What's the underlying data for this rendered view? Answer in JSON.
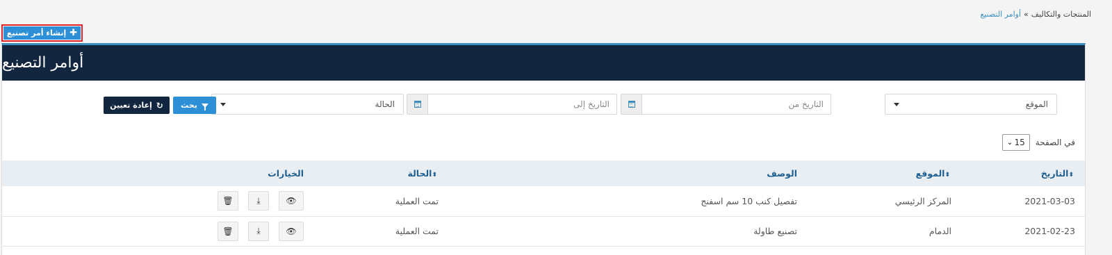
{
  "breadcrumb": {
    "root": "المنتجات والتكاليف",
    "separator": "»",
    "current": "أوامر التصنيع"
  },
  "create_button": {
    "label": "إنشاء أمر تصنيع",
    "icon": "plus-icon"
  },
  "panel": {
    "title": "أوامر التصنيع"
  },
  "filters": {
    "location": {
      "value": "الموقع"
    },
    "date_from": {
      "placeholder": "التاريخ من"
    },
    "date_to": {
      "placeholder": "التاريخ  إلى"
    },
    "status": {
      "value": "الحالة"
    },
    "search_button": "بحث",
    "reset_button": "إعادة تعيين"
  },
  "per_page": {
    "label": "في الصفحة",
    "value": "15"
  },
  "table": {
    "headers": {
      "date": "التاريخ",
      "location": "الموقع",
      "description": "الوصف",
      "status": "الحالة",
      "options": "الخيارات"
    },
    "rows": [
      {
        "date": "2021-03-03",
        "location": "المركز الرئيسي",
        "description": "تفصيل كنب 10 سم اسفنج",
        "status": "تمت العملية"
      },
      {
        "date": "2021-02-23",
        "location": "الدمام",
        "description": "تصنيع طاولة",
        "status": "تمت العملية"
      }
    ]
  },
  "colors": {
    "primary": "#2d8fd6",
    "header_dark": "#13263f",
    "highlight_border": "#e3202a",
    "table_header_bg": "#e8eef2",
    "link": "#3c8dbc"
  }
}
